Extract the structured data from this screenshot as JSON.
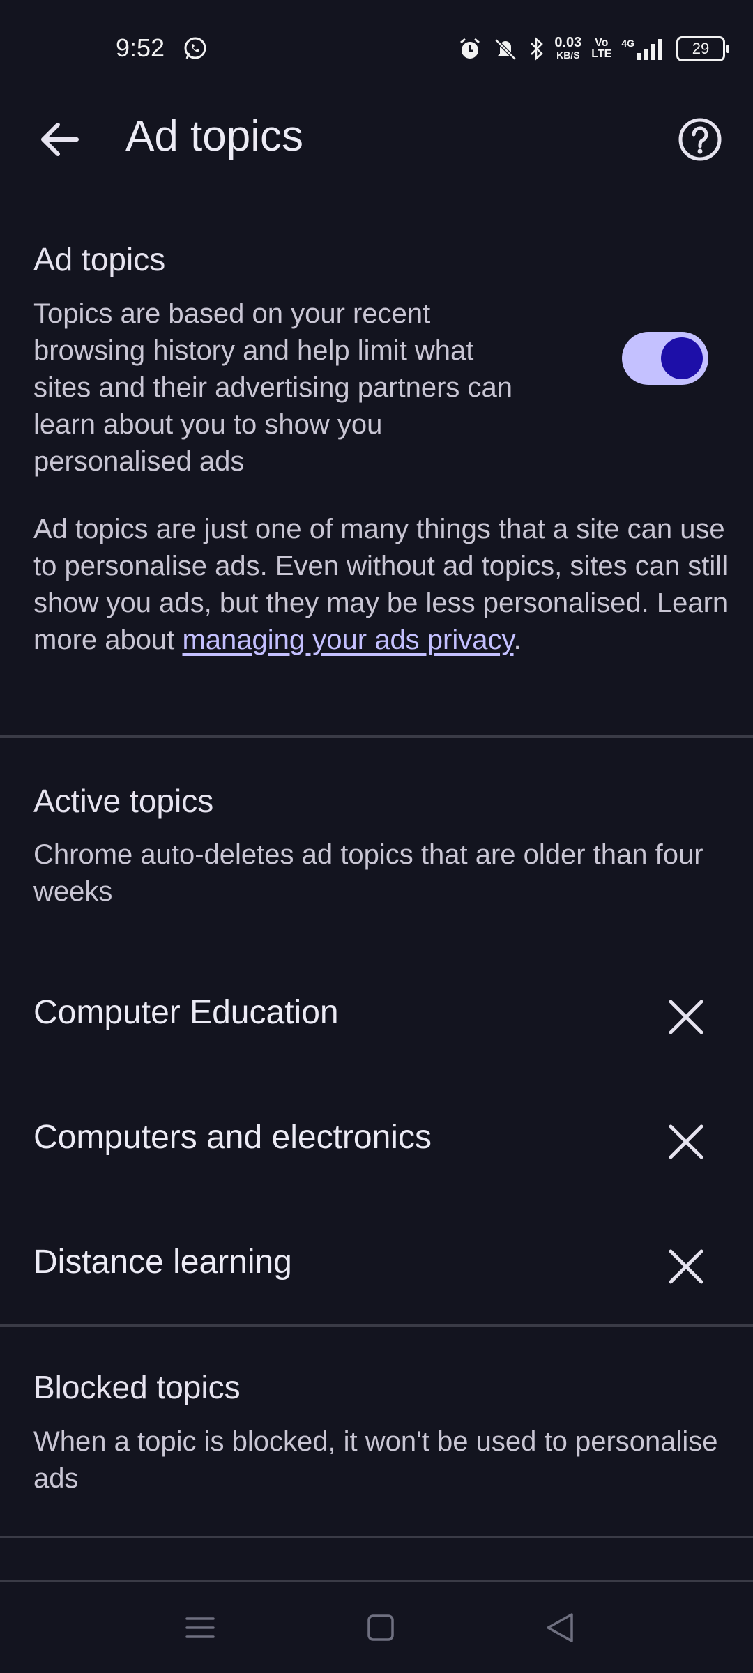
{
  "status_bar": {
    "time": "9:52",
    "net_speed_value": "0.03",
    "net_speed_unit": "KB/S",
    "volte_top": "Vo",
    "volte_bottom": "LTE",
    "network_type": "4G",
    "battery_level": "29"
  },
  "app_bar": {
    "title": "Ad topics"
  },
  "ad_topics_section": {
    "title": "Ad topics",
    "description": "Topics are based on your recent browsing history and help limit what sites and their advertising partners can learn about you to show you personalised ads",
    "toggle_on": true,
    "info_text_1": "Ad topics are just one of many things that a site can use to personalise ads. Even without ad topics, sites can still show you ads, but they may be less personalised. Learn more about ",
    "info_link": "managing your ads privacy",
    "info_text_2": "."
  },
  "active_topics_section": {
    "title": "Active topics",
    "description": "Chrome auto-deletes ad topics that are older than four weeks",
    "topics": [
      {
        "label": "Computer Education"
      },
      {
        "label": "Computers and electronics"
      },
      {
        "label": "Distance learning"
      }
    ]
  },
  "blocked_topics_section": {
    "title": "Blocked topics",
    "description": "When a topic is blocked, it won't be used to personalise ads"
  },
  "colors": {
    "background": "#13141f",
    "toggle_track": "#c4c1ff",
    "toggle_knob": "#1d0fa8",
    "link": "#c4c0ff"
  },
  "icons": [
    "whatsapp-icon",
    "alarm-icon",
    "silent-icon",
    "bluetooth-icon",
    "signal-icon",
    "back-arrow-icon",
    "help-icon",
    "close-icon",
    "menu-icon",
    "home-icon",
    "back-triangle-icon"
  ]
}
